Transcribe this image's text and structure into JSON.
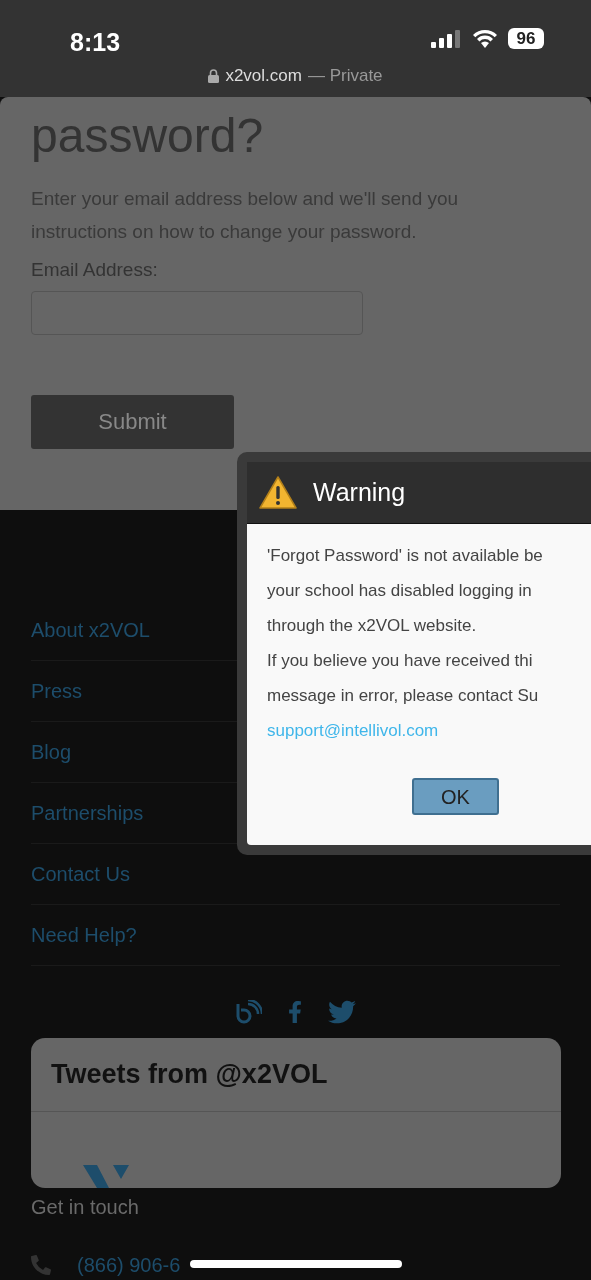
{
  "status_bar": {
    "time": "8:13",
    "battery": "96",
    "address": "x2vol.com",
    "mode": "— Private"
  },
  "form": {
    "title": "password?",
    "intro": "Enter your email address below and we'll send you instructions on how to change your password.",
    "email_label": "Email Address:",
    "submit": "Submit"
  },
  "dialog": {
    "title": "Warning",
    "lines": [
      "'Forgot Password' is not available be",
      "your school has disabled logging in",
      "through the x2VOL website.",
      "If you believe you have received thi",
      "message in error, please contact Su"
    ],
    "link": "support@intellivol.com",
    "ok": "OK"
  },
  "footer": {
    "links": [
      "About x2VOL",
      "Press",
      "Blog",
      "Partnerships",
      "Contact Us",
      "Need Help?"
    ],
    "tweets_title": "Tweets from @x2VOL",
    "contact_heading": "Get in touch",
    "phone": "(866) 906-6"
  }
}
